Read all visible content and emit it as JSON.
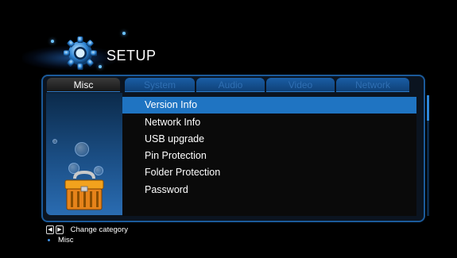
{
  "header": {
    "title": "SETUP",
    "icon": "gear-icon"
  },
  "tabs": [
    {
      "label": "Misc",
      "active": true
    },
    {
      "label": "System",
      "active": false
    },
    {
      "label": "Audio",
      "active": false
    },
    {
      "label": "Video",
      "active": false
    },
    {
      "label": "Network",
      "active": false
    }
  ],
  "menu": {
    "items": [
      {
        "label": "Version Info",
        "selected": true
      },
      {
        "label": "Network Info",
        "selected": false
      },
      {
        "label": "USB upgrade",
        "selected": false
      },
      {
        "label": "Pin Protection",
        "selected": false
      },
      {
        "label": "Folder Protection",
        "selected": false
      },
      {
        "label": "Password",
        "selected": false
      }
    ]
  },
  "footer": {
    "hint": "Change category",
    "current": "Misc"
  },
  "colors": {
    "accent": "#1f74c2",
    "frame": "#1b5a9a"
  }
}
